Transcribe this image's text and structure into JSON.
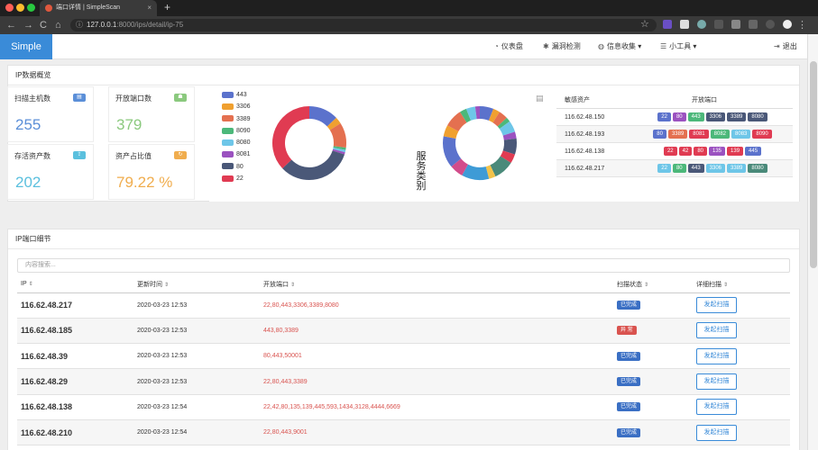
{
  "browser": {
    "tab_title": "端口详情 | SimpleScan",
    "tab_close": "×",
    "new_tab": "+",
    "url_host": "127.0.0.1",
    "url_path": ":8000/ips/detail/ip-75",
    "nav_back": "←",
    "nav_forward": "→",
    "nav_reload": "C",
    "nav_home": "⌂",
    "star": "☆",
    "menu_dots": "⋮"
  },
  "navbar": {
    "brand": "Simple",
    "dashboard": "仪表盘",
    "vuln": "漏洞检测",
    "info": "信息收集",
    "tools": "小工具",
    "logout": "退出",
    "icons": [
      "dashboard-icon",
      "bug-icon",
      "globe-icon",
      "list-icon",
      "logout-icon"
    ]
  },
  "overview": {
    "title": "IP数据概览",
    "cards": [
      {
        "label": "扫描主机数",
        "value": "255",
        "color": "#5b8fd8"
      },
      {
        "label": "开放端口数",
        "value": "379",
        "color": "#8bc97e"
      },
      {
        "label": "存活资产数",
        "value": "202",
        "color": "#5bc0de"
      },
      {
        "label": "资产占比值",
        "value": "79.22 %",
        "color": "#f0ad4e"
      }
    ],
    "legend": [
      {
        "label": "443",
        "color": "#5b72cc"
      },
      {
        "label": "3306",
        "color": "#f0a030"
      },
      {
        "label": "3389",
        "color": "#e47050"
      },
      {
        "label": "8090",
        "color": "#4cb87a"
      },
      {
        "label": "8080",
        "color": "#6ec6e8"
      },
      {
        "label": "8081",
        "color": "#9b52c0"
      },
      {
        "label": "80",
        "color": "#4a5878"
      },
      {
        "label": "22",
        "color": "#e03b52"
      }
    ],
    "service_title": "服务类别",
    "sensitive": {
      "col_asset": "敏感资产",
      "col_ports": "开放端口",
      "rows": [
        {
          "ip": "116.62.48.150",
          "ports": [
            {
              "p": "22",
              "c": "#5b72cc"
            },
            {
              "p": "80",
              "c": "#9b52c0"
            },
            {
              "p": "443",
              "c": "#4cb87a"
            },
            {
              "p": "3306",
              "c": "#4a5878"
            },
            {
              "p": "3389",
              "c": "#4a5878"
            },
            {
              "p": "8080",
              "c": "#4a5878"
            }
          ]
        },
        {
          "ip": "116.62.48.193",
          "ports": [
            {
              "p": "80",
              "c": "#5b72cc"
            },
            {
              "p": "3389",
              "c": "#e47050"
            },
            {
              "p": "8081",
              "c": "#e03b52"
            },
            {
              "p": "8082",
              "c": "#4cb87a"
            },
            {
              "p": "8083",
              "c": "#6ec6e8"
            },
            {
              "p": "8090",
              "c": "#e03b52"
            }
          ]
        },
        {
          "ip": "116.62.48.138",
          "ports": [
            {
              "p": "22",
              "c": "#e03b52"
            },
            {
              "p": "42",
              "c": "#e03b52"
            },
            {
              "p": "80",
              "c": "#e03b52"
            },
            {
              "p": "135",
              "c": "#9b52c0"
            },
            {
              "p": "139",
              "c": "#e03b52"
            },
            {
              "p": "445",
              "c": "#5b72cc"
            }
          ]
        },
        {
          "ip": "116.62.48.217",
          "ports": [
            {
              "p": "22",
              "c": "#6ec6e8"
            },
            {
              "p": "80",
              "c": "#4cb87a"
            },
            {
              "p": "443",
              "c": "#4a5878"
            },
            {
              "p": "3306",
              "c": "#6ec6e8"
            },
            {
              "p": "3389",
              "c": "#6ec6e8"
            },
            {
              "p": "8080",
              "c": "#4a8a7a"
            }
          ]
        }
      ]
    }
  },
  "details": {
    "title": "IP端口细节",
    "search_placeholder": "内容搜索...",
    "columns": [
      "IP",
      "更新时间",
      "开放端口",
      "扫描状态",
      "详细扫描"
    ],
    "button_label": "发起扫描",
    "rows": [
      {
        "ip": "116.62.48.217",
        "time": "2020-03-23 12:53",
        "ports": "22,80,443,3306,3389,8080",
        "status": "已完成",
        "status_color": "#3a6fc4"
      },
      {
        "ip": "116.62.48.185",
        "time": "2020-03-23 12:53",
        "ports": "443,80,3389",
        "status": "异 常",
        "status_color": "#d9534f"
      },
      {
        "ip": "116.62.48.39",
        "time": "2020-03-23 12:53",
        "ports": "80,443,50001",
        "status": "已完成",
        "status_color": "#3a6fc4"
      },
      {
        "ip": "116.62.48.29",
        "time": "2020-03-23 12:53",
        "ports": "22,80,443,3389",
        "status": "已完成",
        "status_color": "#3a6fc4"
      },
      {
        "ip": "116.62.48.138",
        "time": "2020-03-23 12:54",
        "ports": "22,42,80,135,139,445,593,1434,3128,4444,6669",
        "status": "已完成",
        "status_color": "#3a6fc4"
      },
      {
        "ip": "116.62.48.210",
        "time": "2020-03-23 12:54",
        "ports": "22,80,443,9001",
        "status": "已完成",
        "status_color": "#3a6fc4"
      }
    ]
  }
}
